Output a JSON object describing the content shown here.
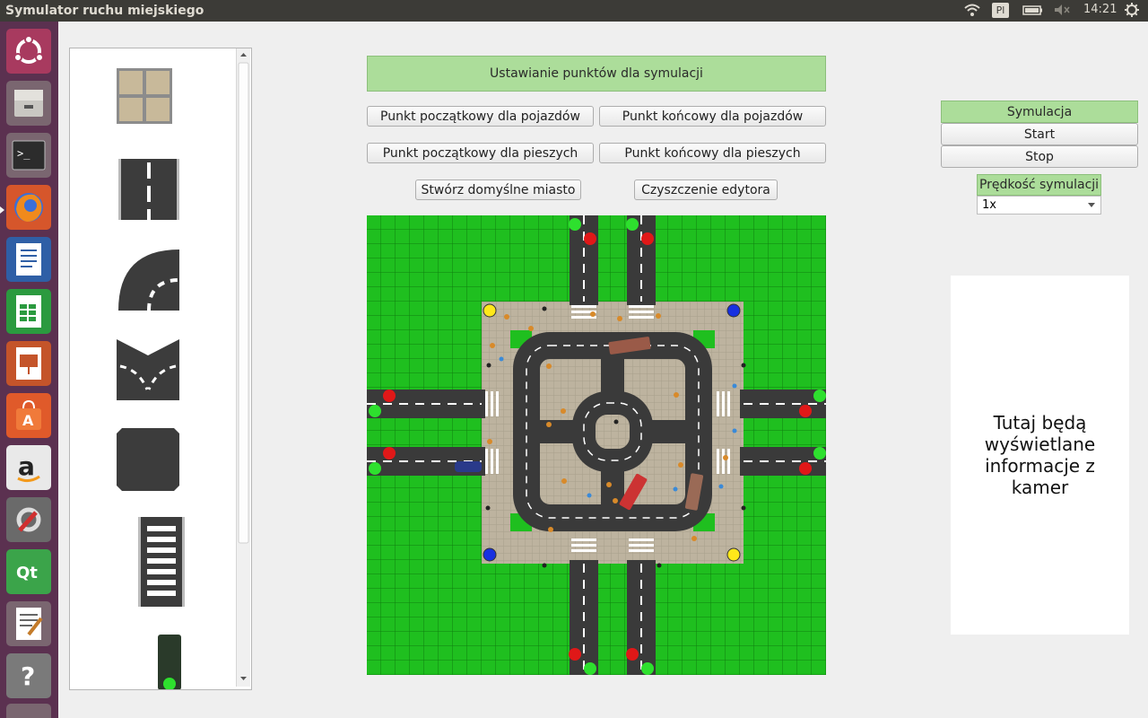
{
  "window": {
    "title": "Symulator ruchu miejskiego"
  },
  "tray": {
    "keyboard": "Pl",
    "time": "14:21"
  },
  "launcher": {
    "items": [
      "ubuntu-dash-icon",
      "files-icon",
      "terminal-icon",
      "firefox-icon",
      "writer-icon",
      "calc-icon",
      "impress-icon",
      "software-center-icon",
      "amazon-icon",
      "settings-icon",
      "qt-creator-icon",
      "text-editor-icon",
      "help-icon"
    ]
  },
  "palette": {
    "items": [
      "pavement-tile",
      "straight-road-tile",
      "curve-road-tile",
      "fork-road-tile",
      "intersection-tile",
      "crosswalk-tile",
      "traffic-light-tile"
    ]
  },
  "points": {
    "banner": "Ustawianie punktów dla symulacji",
    "vehicle_start": "Punkt początkowy dla pojazdów",
    "vehicle_end": "Punkt końcowy dla pojazdów",
    "pedestrian_start": "Punkt początkowy dla pieszych",
    "pedestrian_end": "Punkt końcowy dla pieszych",
    "default_city": "Stwórz domyślne miasto",
    "clear_editor": "Czyszczenie edytora"
  },
  "simulation": {
    "label": "Symulacja",
    "start": "Start",
    "stop": "Stop",
    "speed_label": "Prędkość symulacji",
    "speed_value": "1x"
  },
  "camera": {
    "text": "Tutaj będą wyświetlane informacje z kamer"
  },
  "colors": {
    "accent_green": "#acdd9a",
    "grass": "#1fbf1f",
    "launcher_bg": "#5b3150",
    "topbar_bg": "#3c3b37"
  }
}
